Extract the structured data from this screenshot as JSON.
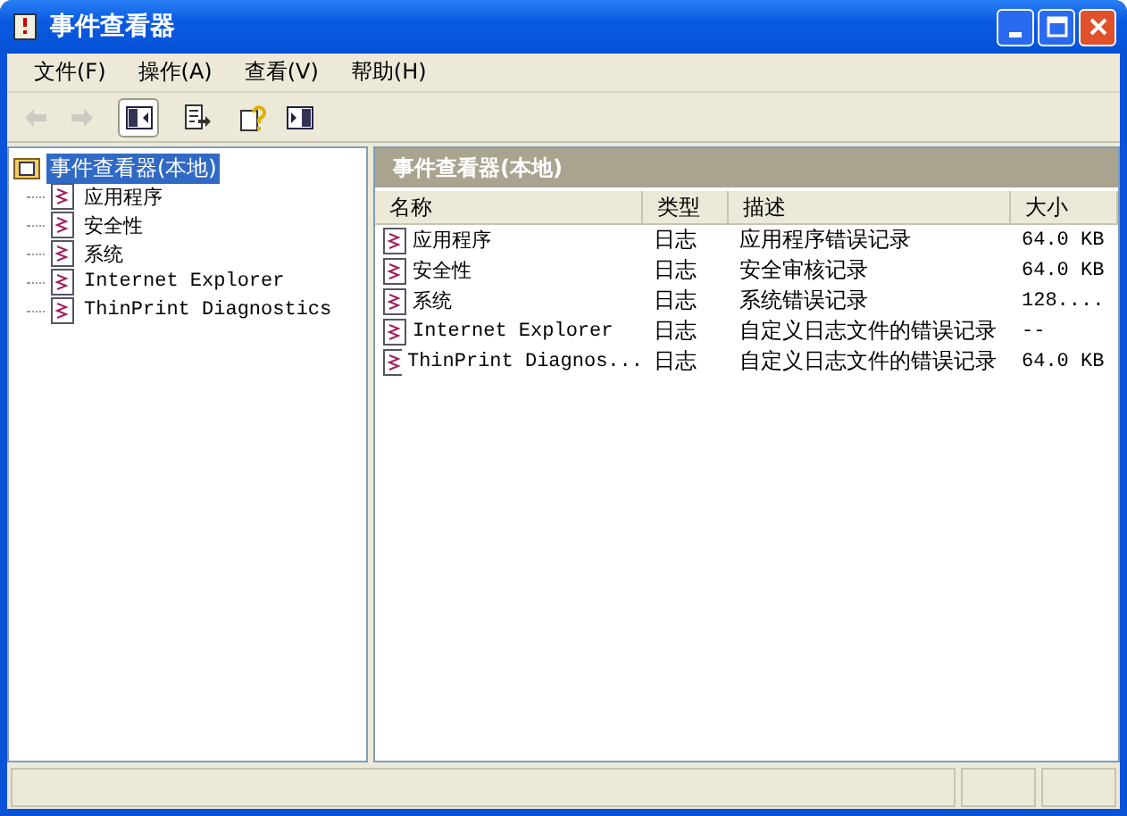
{
  "window": {
    "title": "事件查看器"
  },
  "menu": [
    {
      "label": "文件(F)"
    },
    {
      "label": "操作(A)"
    },
    {
      "label": "查看(V)"
    },
    {
      "label": "帮助(H)"
    }
  ],
  "toolbar": [
    {
      "kind": "back",
      "disabled": true,
      "selected": false
    },
    {
      "kind": "forward",
      "disabled": true,
      "selected": false
    },
    {
      "kind": "tree",
      "disabled": false,
      "selected": true
    },
    {
      "kind": "export",
      "disabled": false,
      "selected": false
    },
    {
      "kind": "help",
      "disabled": false,
      "selected": false
    },
    {
      "kind": "pane",
      "disabled": false,
      "selected": false
    }
  ],
  "tree": {
    "label": "事件查看器(本地)",
    "selected": true,
    "children": [
      {
        "label": "应用程序",
        "selected": false
      },
      {
        "label": "安全性",
        "selected": false
      },
      {
        "label": "系统",
        "selected": false
      },
      {
        "label": "Internet Explorer",
        "selected": false
      },
      {
        "label": "ThinPrint Diagnostics",
        "selected": false
      }
    ]
  },
  "pane": {
    "title": "事件查看器(本地)"
  },
  "table": {
    "columns": [
      "名称",
      "类型",
      "描述",
      "大小"
    ],
    "rows": [
      [
        "应用程序",
        "日志",
        "应用程序错误记录",
        "64.0 KB"
      ],
      [
        "安全性",
        "日志",
        "安全审核记录",
        "64.0 KB"
      ],
      [
        "系统",
        "日志",
        "系统错误记录",
        "128...."
      ],
      [
        "Internet Explorer",
        "日志",
        "自定义日志文件的错误记录",
        "--"
      ],
      [
        "ThinPrint Diagnos...",
        "日志",
        "自定义日志文件的错误记录",
        "64.0 KB"
      ]
    ]
  }
}
